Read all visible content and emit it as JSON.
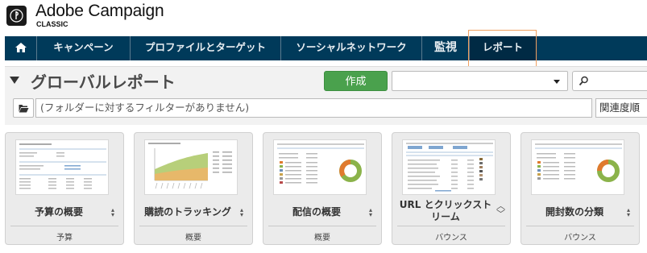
{
  "brand": {
    "name": "Adobe Campaign",
    "edition": "CLASSIC"
  },
  "nav": {
    "home_icon": "home-icon",
    "items": [
      {
        "label": "キャンペーン"
      },
      {
        "label": "プロファイルとターゲット"
      },
      {
        "label": "ソーシャルネットワーク"
      },
      {
        "label": "監視"
      },
      {
        "label": "レポート",
        "active": true
      }
    ]
  },
  "toolbar": {
    "title": "グローバルレポート",
    "create_label": "作成",
    "select_value": "",
    "search_value": "",
    "filter_text": "(フォルダーに対するフィルターがありません)",
    "sort_label": "関連度順"
  },
  "cards": [
    {
      "title": "予算の概要",
      "category": "予算",
      "thumb": "budget-table"
    },
    {
      "title": "購読のトラッキング",
      "category": "概要",
      "thumb": "area-chart"
    },
    {
      "title": "配信の概要",
      "category": "概要",
      "thumb": "donut-table"
    },
    {
      "title": "URL とクリックストリーム",
      "category": "バウンス",
      "thumb": "stats-table"
    },
    {
      "title": "開封数の分類",
      "category": "バウンス",
      "thumb": "donut-table"
    }
  ],
  "colors": {
    "nav_bg": "#003a5a",
    "create_button": "#4aa14d",
    "highlight": "#f0a060"
  }
}
